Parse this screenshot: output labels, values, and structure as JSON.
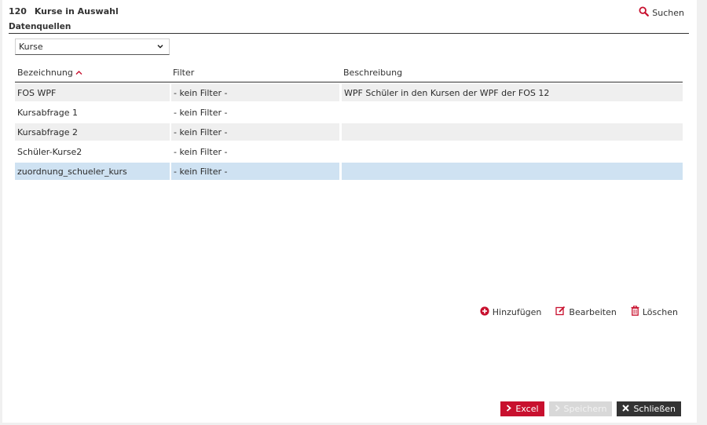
{
  "header": {
    "count": "120",
    "title": "Kurse in Auswahl",
    "search_label": "Suchen"
  },
  "section": {
    "title": "Datenquellen",
    "select_value": "Kurse"
  },
  "table": {
    "columns": [
      "Bezeichnung",
      "Filter",
      "Beschreibung"
    ],
    "rows": [
      {
        "name": "FOS WPF",
        "filter": "- kein Filter -",
        "description": "WPF Schüler in den Kursen der WPF der FOS 12"
      },
      {
        "name": "Kursabfrage 1",
        "filter": "- kein Filter -",
        "description": ""
      },
      {
        "name": "Kursabfrage 2",
        "filter": "- kein Filter -",
        "description": ""
      },
      {
        "name": "Schüler-Kurse2",
        "filter": "- kein Filter -",
        "description": ""
      },
      {
        "name": "zuordnung_schueler_kurs",
        "filter": "- kein Filter -",
        "description": ""
      }
    ]
  },
  "actions": {
    "add": "Hinzufügen",
    "edit": "Bearbeiten",
    "delete": "Löschen"
  },
  "footer": {
    "excel": "Excel",
    "save": "Speichern",
    "close": "Schließen"
  },
  "colors": {
    "accent": "#c8102e",
    "selected_row": "#cfe2f2",
    "alt_row": "#efefef",
    "dark_button": "#333333"
  }
}
